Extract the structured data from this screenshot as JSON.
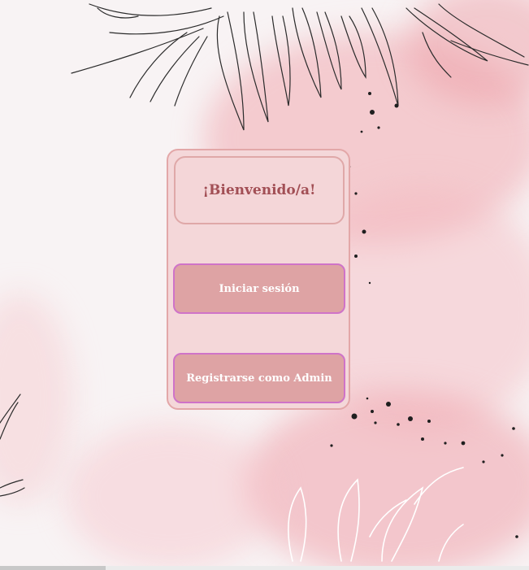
{
  "welcome_text": "¡Bienvenido/a!",
  "buttons": {
    "login": "Iniciar sesión",
    "register_admin": "Registrarse como Admin"
  },
  "colors": {
    "card_bg": "#f4d7d9",
    "button_bg": "#dea3a4",
    "button_border": "#cf73c8",
    "welcome_text": "#a24f55"
  }
}
